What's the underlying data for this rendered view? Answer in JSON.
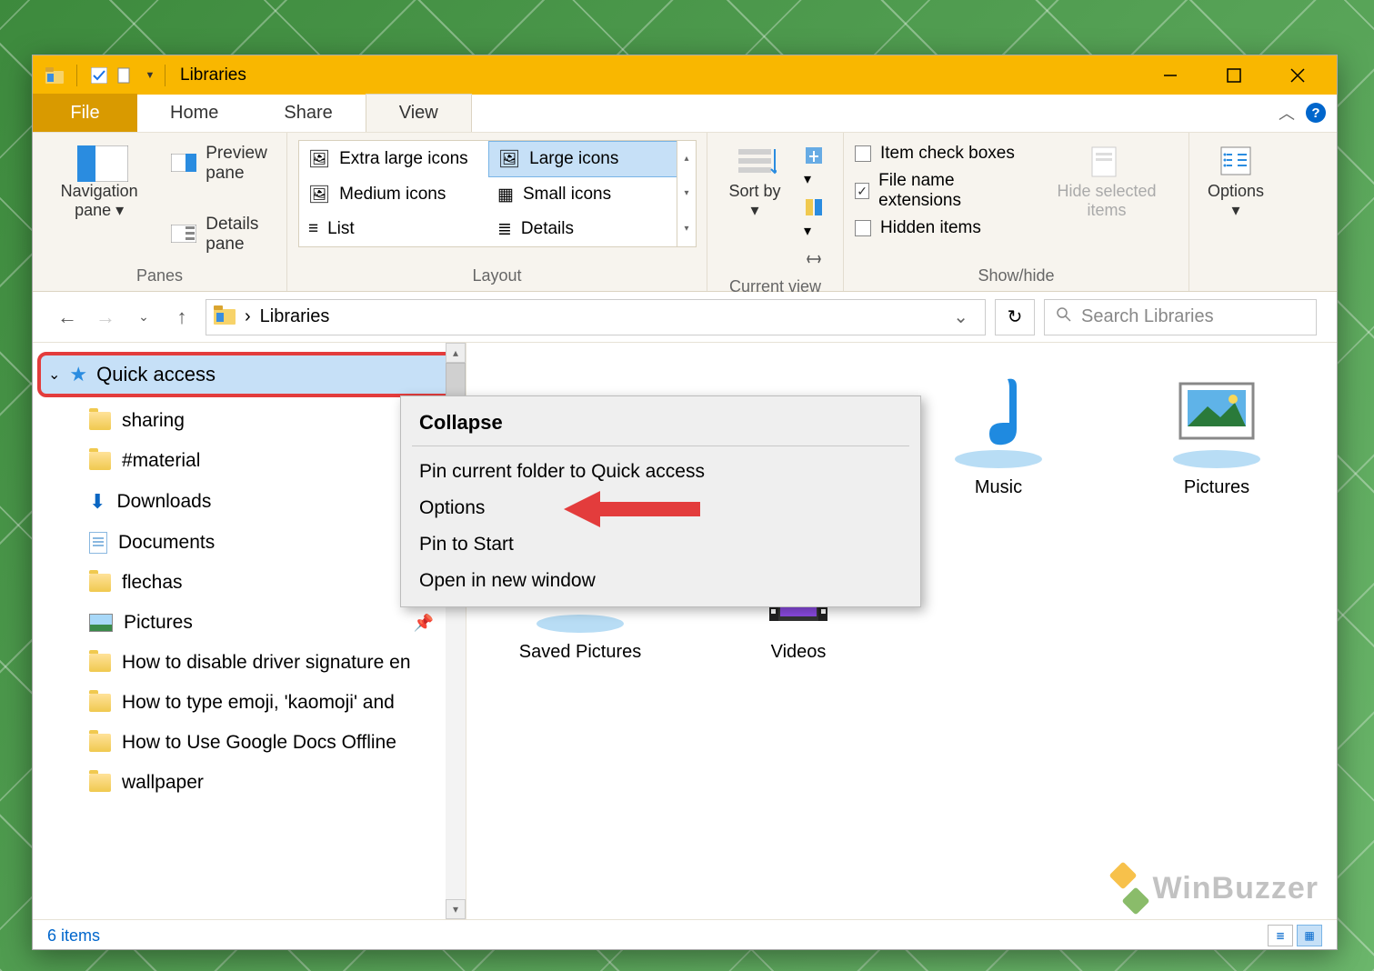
{
  "window_title": "Libraries",
  "tabs": {
    "file": "File",
    "home": "Home",
    "share": "Share",
    "view": "View"
  },
  "ribbon": {
    "panes": {
      "label": "Panes",
      "navigation": "Navigation pane",
      "preview": "Preview pane",
      "details": "Details pane"
    },
    "layout": {
      "label": "Layout",
      "extra_large": "Extra large icons",
      "large": "Large icons",
      "medium": "Medium icons",
      "small": "Small icons",
      "list": "List",
      "details": "Details"
    },
    "current_view": {
      "label": "Current view",
      "sort_by": "Sort by"
    },
    "show_hide": {
      "label": "Show/hide",
      "item_check": "Item check boxes",
      "file_ext": "File name extensions",
      "hidden": "Hidden items",
      "hide_selected": "Hide selected items"
    },
    "options": "Options"
  },
  "addressbar": {
    "location": "Libraries",
    "chevron": "›"
  },
  "search": {
    "placeholder": "Search Libraries"
  },
  "sidebar": {
    "quick_access": "Quick access",
    "items": [
      {
        "label": "sharing",
        "icon": "folder",
        "pinned": false
      },
      {
        "label": "#material",
        "icon": "folder",
        "pinned": false
      },
      {
        "label": "Downloads",
        "icon": "downloads",
        "pinned": false
      },
      {
        "label": "Documents",
        "icon": "document",
        "pinned": false
      },
      {
        "label": "flechas",
        "icon": "folder",
        "pinned": true
      },
      {
        "label": "Pictures",
        "icon": "picture",
        "pinned": true
      },
      {
        "label": "How to disable driver signature en",
        "icon": "folder",
        "pinned": false
      },
      {
        "label": "How to type emoji, 'kaomoji' and",
        "icon": "folder",
        "pinned": false
      },
      {
        "label": "How to Use Google Docs Offline",
        "icon": "folder",
        "pinned": false
      },
      {
        "label": "wallpaper",
        "icon": "folder",
        "pinned": false
      }
    ]
  },
  "libraries": [
    {
      "label": "Music"
    },
    {
      "label": "Pictures"
    },
    {
      "label": "Saved Pictures"
    },
    {
      "label": "Videos"
    }
  ],
  "context_menu": {
    "title": "Collapse",
    "items": [
      "Pin current folder to Quick access",
      "Options",
      "Pin to Start",
      "Open in new window"
    ]
  },
  "statusbar": {
    "count": "6 items"
  },
  "watermark": "WinBuzzer",
  "checked": {
    "file_ext": true,
    "item_check": false,
    "hidden": false
  }
}
